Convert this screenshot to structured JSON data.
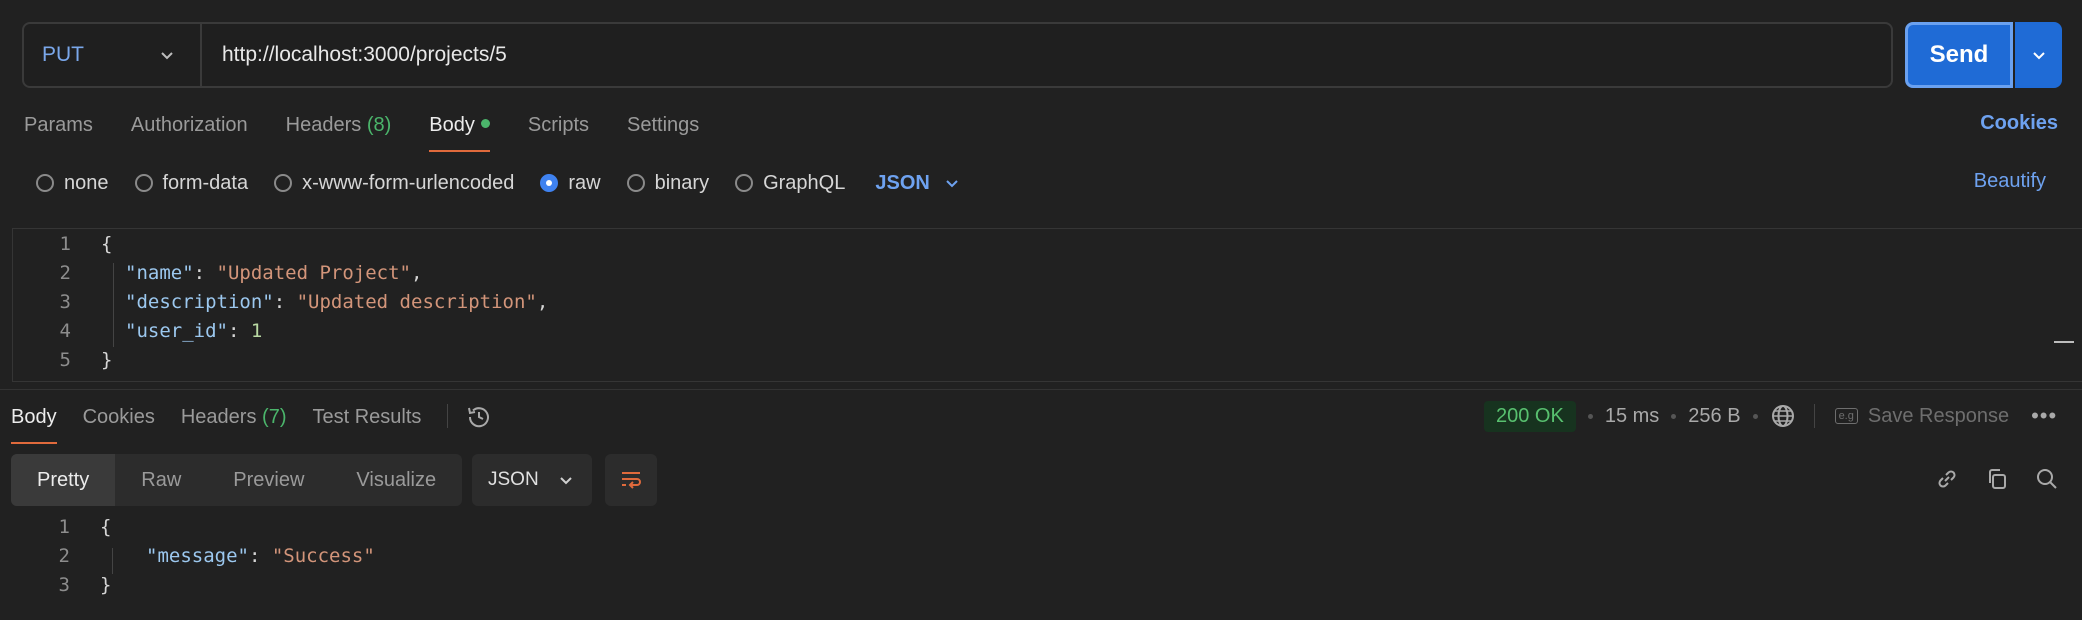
{
  "request": {
    "method": "PUT",
    "url": "http://localhost:3000/projects/5",
    "send_label": "Send"
  },
  "request_tabs": {
    "params": "Params",
    "authorization": "Authorization",
    "headers": "Headers",
    "headers_count": "(8)",
    "body": "Body",
    "scripts": "Scripts",
    "settings": "Settings",
    "cookies": "Cookies"
  },
  "body_types": {
    "none": "none",
    "form_data": "form-data",
    "urlencoded": "x-www-form-urlencoded",
    "raw": "raw",
    "binary": "binary",
    "graphql": "GraphQL",
    "language": "JSON",
    "beautify": "Beautify",
    "selected": "raw"
  },
  "request_body": {
    "line_numbers": [
      "1",
      "2",
      "3",
      "4",
      "5"
    ],
    "open_brace": "{",
    "close_brace": "}",
    "k1": "\"name\"",
    "v1": "\"Updated Project\"",
    "k2": "\"description\"",
    "v2": "\"Updated description\"",
    "k3": "\"user_id\"",
    "v3": "1",
    "colon": ": ",
    "comma": ","
  },
  "response_tabs": {
    "body": "Body",
    "cookies": "Cookies",
    "headers": "Headers",
    "headers_count": "(7)",
    "test_results": "Test Results"
  },
  "response_meta": {
    "status": "200 OK",
    "time": "15 ms",
    "size": "256 B",
    "save_icon_text": "e.g",
    "save_response": "Save Response",
    "more": "•••"
  },
  "response_views": {
    "pretty": "Pretty",
    "raw": "Raw",
    "preview": "Preview",
    "visualize": "Visualize",
    "format": "JSON"
  },
  "response_body": {
    "line_numbers": [
      "1",
      "2",
      "3"
    ],
    "open_brace": "{",
    "close_brace": "}",
    "k1": "\"message\"",
    "v1": "\"Success\"",
    "colon": ": "
  },
  "colors": {
    "accent_blue": "#1f6bd6",
    "link_blue": "#6ea2f0",
    "active_tab_underline": "#e06a3c",
    "status_green": "#58c06f",
    "background": "#212121"
  }
}
